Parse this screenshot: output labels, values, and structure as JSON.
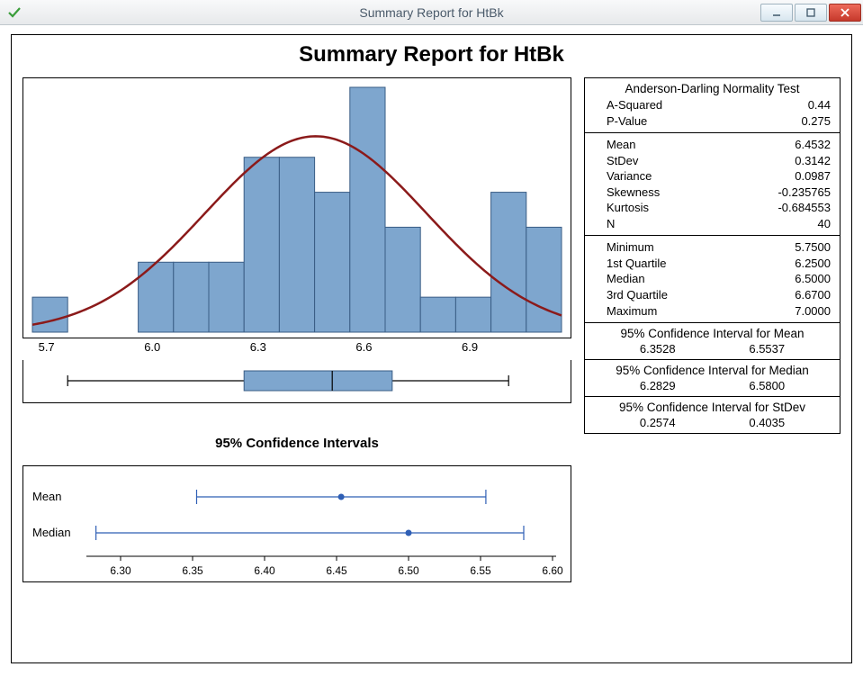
{
  "window": {
    "title": "Summary Report for HtBk"
  },
  "report": {
    "title": "Summary Report for HtBk"
  },
  "stats": {
    "normality": {
      "title": "Anderson-Darling Normality Test",
      "a_squared_label": "A-Squared",
      "a_squared": "0.44",
      "p_label": "P-Value",
      "p": "0.275"
    },
    "descriptive": {
      "mean_label": "Mean",
      "mean": "6.4532",
      "stdev_label": "StDev",
      "stdev": "0.3142",
      "variance_label": "Variance",
      "variance": "0.0987",
      "skewness_label": "Skewness",
      "skewness": "-0.235765",
      "kurtosis_label": "Kurtosis",
      "kurtosis": "-0.684553",
      "n_label": "N",
      "n": "40"
    },
    "quartiles": {
      "min_label": "Minimum",
      "min": "5.7500",
      "q1_label": "1st Quartile",
      "q1": "6.2500",
      "median_label": "Median",
      "median": "6.5000",
      "q3_label": "3rd Quartile",
      "q3": "6.6700",
      "max_label": "Maximum",
      "max": "7.0000"
    },
    "ci_mean": {
      "title": "95% Confidence Interval for Mean",
      "lo": "6.3528",
      "hi": "6.5537"
    },
    "ci_median": {
      "title": "95% Confidence Interval for Median",
      "lo": "6.2829",
      "hi": "6.5800"
    },
    "ci_stdev": {
      "title": "95% Confidence Interval for StDev",
      "lo": "0.2574",
      "hi": "0.4035"
    }
  },
  "ci_panel": {
    "title": "95% Confidence Intervals",
    "mean_label": "Mean",
    "median_label": "Median"
  },
  "chart_data": [
    {
      "type": "bar",
      "name": "histogram_with_normal_curve",
      "x_bin_centers": [
        5.7,
        5.8,
        5.9,
        6.0,
        6.1,
        6.2,
        6.3,
        6.4,
        6.5,
        6.6,
        6.7,
        6.8,
        6.9,
        7.0,
        7.1
      ],
      "counts": [
        1,
        0,
        0,
        2,
        2,
        2,
        5,
        5,
        4,
        7,
        3,
        1,
        1,
        4,
        3
      ],
      "x_ticks": [
        5.7,
        6.0,
        6.3,
        6.6,
        6.9
      ],
      "normal_curve": {
        "mean": 6.4532,
        "stdev": 0.3142
      },
      "barcolor": "#7ea6ce",
      "curvecolor": "#8b1a1a"
    },
    {
      "type": "boxplot",
      "name": "boxplot",
      "min": 5.75,
      "q1": 6.25,
      "median": 6.5,
      "q3": 6.67,
      "max": 7.0,
      "x_range": [
        5.65,
        7.15
      ]
    },
    {
      "type": "errorbar",
      "name": "confidence_intervals",
      "series": [
        {
          "name": "Mean",
          "lo": 6.3528,
          "point": 6.4532,
          "hi": 6.5537
        },
        {
          "name": "Median",
          "lo": 6.2829,
          "point": 6.5,
          "hi": 6.58
        }
      ],
      "x_ticks": [
        6.3,
        6.35,
        6.4,
        6.45,
        6.5,
        6.55,
        6.6
      ],
      "x_range": [
        6.28,
        6.6
      ]
    }
  ]
}
